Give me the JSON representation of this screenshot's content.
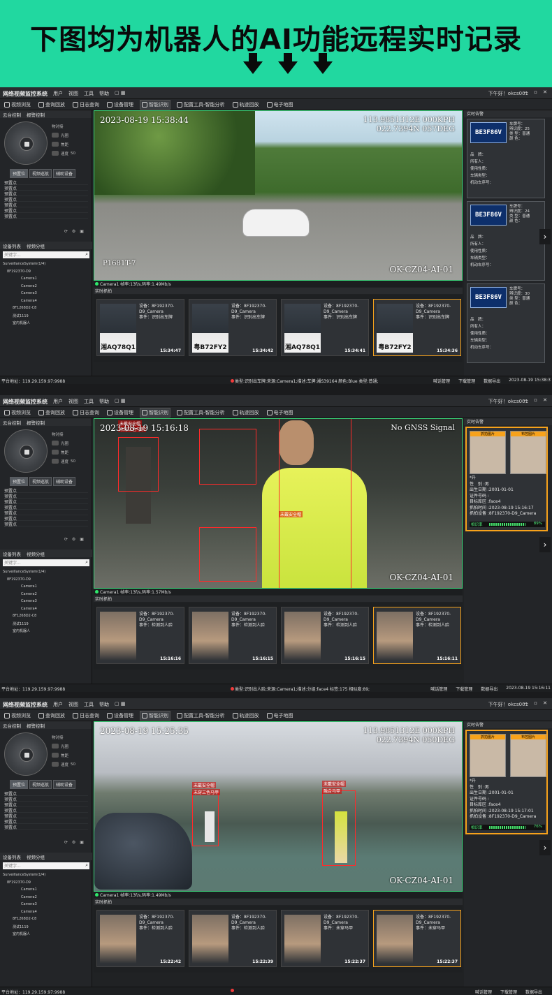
{
  "banner": {
    "title": "下图均为机器人的AI功能远程实时记录",
    "bg_color": "#21d8a0",
    "arrow_icons": [
      "down-arrow-icon",
      "down-arrow-icon",
      "down-arrow-icon"
    ]
  },
  "app": {
    "system_title": "网络视频监控系统",
    "menus": [
      "用户",
      "视图",
      "工具",
      "帮助"
    ],
    "greeting": "下午好！okcs001",
    "toolbar": [
      "视频浏览",
      "查询回放",
      "日志查询",
      "设备管理",
      "智能识别",
      "配置工具-智能分析",
      "轨迹回放",
      "电子地图"
    ],
    "active_tool": "智能识别",
    "left": {
      "tabs": [
        "云台控制",
        "报警控制"
      ],
      "ptz_labels": [
        "物对接",
        "光圈",
        "焦距",
        "速度"
      ],
      "speed_value": "50",
      "preset_buttons": [
        "预置位",
        "视频巡航",
        "辅助设备"
      ],
      "presets": [
        "预置点",
        "预置点",
        "预置点",
        "预置点",
        "预置点",
        "预置点",
        "预置点"
      ],
      "device_tabs": [
        "设备列表",
        "视频分组"
      ],
      "search_placeholder": "关键字...",
      "tree": [
        "SurveillanceSystem(1/4)",
        "8F192370-D9",
        "Camera1",
        "Camera2",
        "Camera3",
        "Camera4",
        "8F1268D2-C8",
        "测试1119",
        "室内机器人"
      ]
    },
    "capture_header": "实时抓拍",
    "right_header": "实时告警",
    "status_address": "平台地址：119.29.159.97:9988",
    "status_actions": [
      "喊话管理",
      "下载管理",
      "数据导出"
    ]
  },
  "screens": [
    {
      "osd_time": "2023-08-19 15:38:44",
      "osd_gps": [
        "113.9851312E 000KPH",
        "022.7394N 057DEG"
      ],
      "osd_camera": "OK-CZ04-AI-01",
      "osd_plate_text": "P1681T-7",
      "video_status": "Camera1 帧率:13f/s,码率:1.49Mb/s",
      "captures": [
        {
          "plate": "湘AQ78Q1",
          "device": "设备：8F192370-D9_Camera",
          "event": "事件：识别出车牌",
          "time": "15:34:47"
        },
        {
          "plate": "粤B72FY2",
          "device": "设备：8F192370-D9_Camera",
          "event": "事件：识别出车牌",
          "time": "15:34:42"
        },
        {
          "plate": "湘AQ78Q1",
          "device": "设备：8F192370-D9_Camera",
          "event": "事件：识别出车牌",
          "time": "15:34:41"
        },
        {
          "plate": "粤B72FY2",
          "device": "设备：8F192370-D9_Camera",
          "event": "事件：识别出车牌",
          "time": "15:34:36"
        }
      ],
      "plate_cards": [
        {
          "plate": "BE3F86V",
          "lines": [
            "车牌号：",
            "辨识度：25",
            "类  型：普通",
            "颜  色："
          ],
          "fields": [
            "品　牌：",
            "所有人：",
            "使用性质：",
            "车辆类型：",
            "机动车序号："
          ]
        },
        {
          "plate": "BE3F86V",
          "lines": [
            "车牌号：",
            "辨识度：24",
            "类  型：普通",
            "颜  色："
          ],
          "fields": [
            "品　牌：",
            "所有人：",
            "使用性质：",
            "车辆类型：",
            "机动车序号："
          ]
        },
        {
          "plate": "BE3F86V",
          "lines": [
            "车牌号：",
            "辨识度：30",
            "类  型：普通",
            "颜  色："
          ],
          "fields": [
            "品　牌：",
            "所有人：",
            "使用性质：",
            "车辆类型：",
            "机动车序号："
          ]
        }
      ],
      "status_msg": "类型:识别出车牌;来源:Camera1;描述:车牌:湘S39164 颜色:Blue 类型:普通;",
      "status_time": "2023-08-19 15:38:3"
    },
    {
      "osd_time": "2023-08-19 15:16:18",
      "osd_gps": [
        "No GNSS Signal"
      ],
      "osd_camera": "OK-CZ04-AI-01",
      "face_labels": [
        "未戴安全帽",
        "未穿三色马甲",
        "未戴安全帽",
        "未穿马甲"
      ],
      "video_status": "Camera1 帧率:13f/s,码率:1.57Mb/s",
      "captures": [
        {
          "device": "设备：8F192370-D9_Camera",
          "event": "事件：检测到人脸",
          "time": "15:16:16"
        },
        {
          "device": "设备：8F192370-D9_Camera",
          "event": "事件：检测到人脸",
          "time": "15:16:15"
        },
        {
          "device": "设备：8F192370-D9_Camera",
          "event": "事件：检测到人脸",
          "time": "15:16:15"
        },
        {
          "device": "设备：8F192370-D9_Camera",
          "event": "事件：检测到人脸",
          "time": "15:16:11"
        }
      ],
      "face_card": {
        "tags": [
          "抓拍图片",
          "布控图片"
        ],
        "lines": [
          "*升",
          "性　别 :男",
          "出生日期 :2001-01-01",
          "证件号码 :",
          "目标库区 :face4",
          "抓拍时间 :2023-08-19 15:16:17",
          "抓拍设备 :8F192370-D9_Camera"
        ],
        "similarity_label": "相识率",
        "similarity": "89%"
      },
      "status_msg": "类型:识别出人脸;来源:Camera1;描述:分组:face4 标签:175 相似度:89;",
      "status_time": "2023-08-19 15:16:11"
    },
    {
      "osd_time": "2023-08-19 15:25:35",
      "osd_gps": [
        "113.9851312E 000KPH",
        "022.7394N 050DEG"
      ],
      "osd_camera": "OK-CZ04-AI-01",
      "face_labels": [
        "未戴安全帽",
        "未穿三色马甲",
        "未戴安全帽",
        "融合马甲"
      ],
      "video_status": "Camera1 帧率:13f/s,码率:1.49Mb/s",
      "captures": [
        {
          "device": "设备：8F192370-D9_Camera",
          "event": "事件：检测到人脸",
          "time": "15:22:42"
        },
        {
          "device": "设备：8F192370-D9_Camera",
          "event": "事件：检测到人脸",
          "time": "15:22:39"
        },
        {
          "device": "设备：8F192370-D9_Camera",
          "event": "事件：未穿马甲",
          "time": "15:22:37"
        },
        {
          "device": "设备：8F192370-D9_Camera",
          "event": "事件：未穿马甲",
          "time": "15:22:37"
        }
      ],
      "face_card": {
        "tags": [
          "抓拍图片",
          "布控图片"
        ],
        "lines": [
          "*升",
          "性　别 :男",
          "出生日期 :2001-01-01",
          "证件号码 :",
          "目标库区 :face4",
          "抓拍时间 :2023-08-19 15:17:01",
          "抓拍设备 :8F192370-D9_Camera"
        ],
        "similarity_label": "相识率",
        "similarity": "76%"
      },
      "status_msg": "",
      "status_time": ""
    }
  ]
}
